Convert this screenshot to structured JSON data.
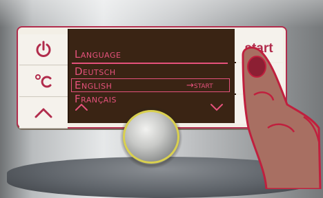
{
  "display": {
    "title": "Language",
    "options": [
      {
        "label": "Deutsch"
      },
      {
        "label": "English",
        "selected": true,
        "action": "→start"
      },
      {
        "label": "Français"
      }
    ]
  },
  "buttons": {
    "power": {
      "icon": "power-icon"
    },
    "temperature": {
      "icon": "celsius-icon"
    },
    "up": {
      "icon": "chevron-up-icon"
    },
    "start": {
      "label": "start"
    }
  },
  "display_nav": {
    "up_icon": "chevron-up-icon",
    "down_icon": "chevron-down-icon"
  },
  "colors": {
    "accent": "#e6527c",
    "border": "#b12c4c",
    "screen_bg": "#3a2414",
    "knob_ring": "#d9d04f"
  }
}
